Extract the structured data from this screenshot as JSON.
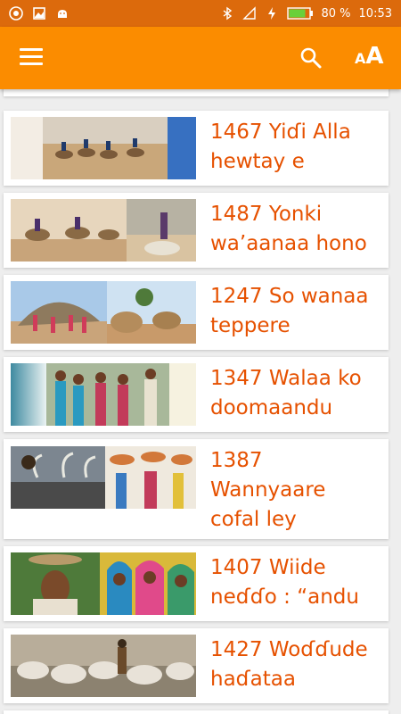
{
  "status_bar": {
    "battery": "80 %",
    "time": "10:53"
  },
  "toolbar": {
    "menu_icon": "hamburger-menu-icon",
    "search_icon": "search-icon",
    "font_size_icon": "font-size-icon",
    "font_label_small": "A",
    "font_label_big": "A"
  },
  "articles": [
    {
      "title": "1467 Yiɗi Alla hewtay e"
    },
    {
      "title": "1487 Yonki wa’aanaa hono"
    },
    {
      "title": "1247 So wanaa teppere"
    },
    {
      "title": "1347 Walaa ko doomaandu"
    },
    {
      "title": "1387 Wannyaare cofal ley"
    },
    {
      "title": "1407 Wiide neɗɗo : “andu"
    },
    {
      "title": "1427 Woɗɗude haɗataa"
    }
  ],
  "colors": {
    "appbar": "#fb8c00",
    "statusbar": "#dc6a0c",
    "title_text": "#e65100",
    "background": "#eeeeee"
  }
}
